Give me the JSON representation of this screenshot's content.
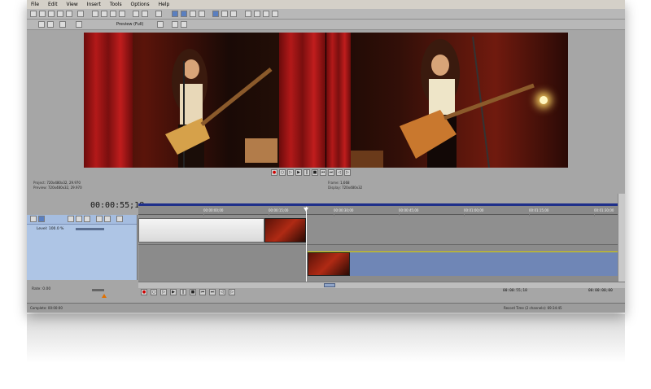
{
  "menu": [
    "File",
    "Edit",
    "View",
    "Insert",
    "Tools",
    "Options",
    "Help"
  ],
  "preview_mode": "Preview (Full)",
  "project_info": {
    "project_label": "Project:",
    "project_value": "720x480x32, 29.970",
    "preview_label": "Preview:",
    "preview_value": "720x480x32, 29.970",
    "frame_label": "Frame:",
    "frame_value": "1,668",
    "display_label": "Display:",
    "display_value": "720x480x32"
  },
  "timecode": "00:00:55;18",
  "track": {
    "level_label": "Level: 100.0 %"
  },
  "ruler_ticks": [
    "00:00:00;00",
    "00:00:15;00",
    "00:00:30;00",
    "00:00:45;00",
    "00:01:00;00",
    "00:01:15;00",
    "00:01:30;00"
  ],
  "rate": "Rate: 0.00",
  "bottom_times": [
    "00:00:55;18",
    "00:00:00;00"
  ],
  "status": {
    "left": "Complete: 00:00:00",
    "right": "Record Time (2 channels): 69:34:45"
  },
  "colors": {
    "ruler_bar": "#1e2f8a",
    "track_panel": "#aec5e5",
    "clip_blue": "#6f86b6",
    "record": "#d00000"
  }
}
